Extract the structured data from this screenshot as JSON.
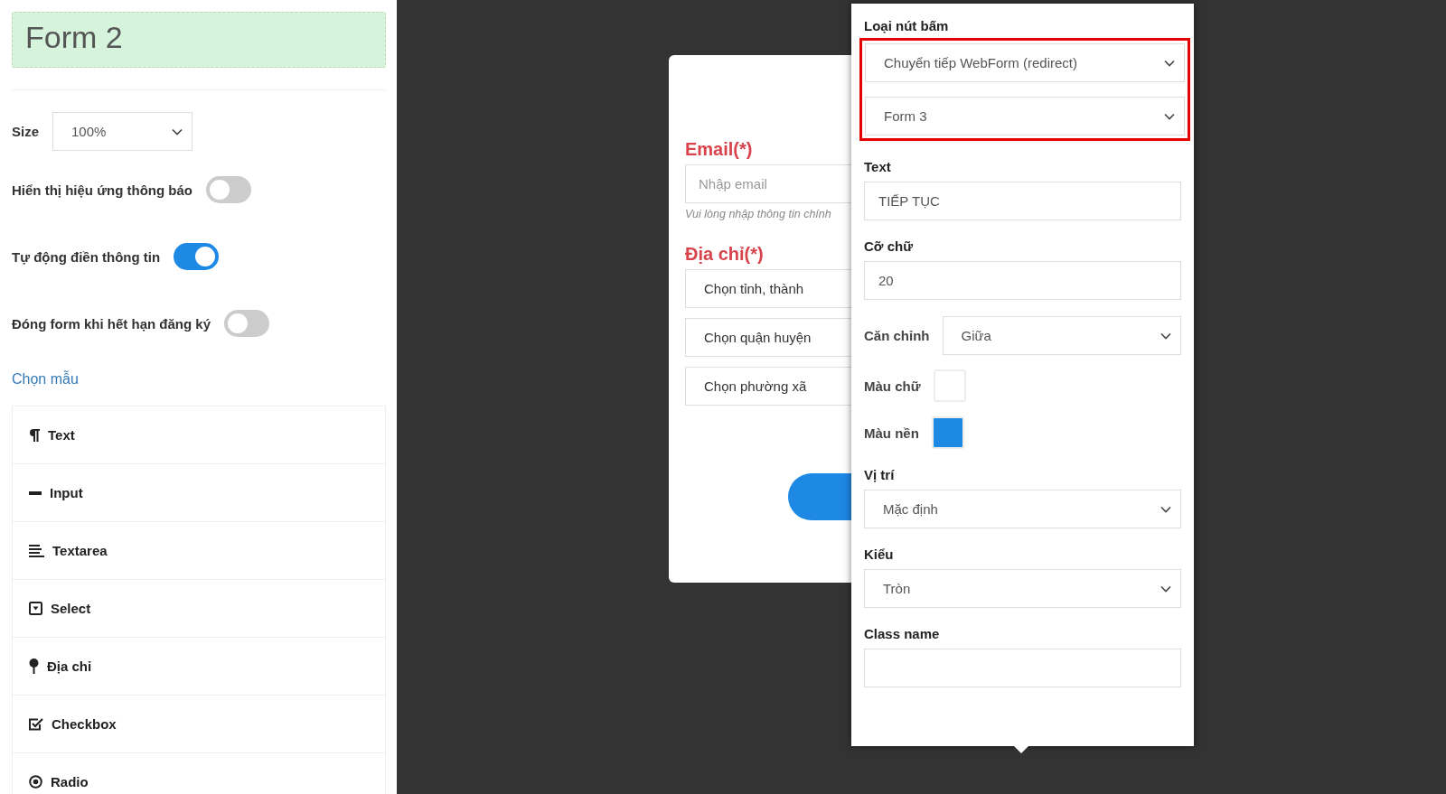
{
  "sidebar": {
    "title": "Form 2",
    "size": {
      "label": "Size",
      "value": "100%"
    },
    "toggles": [
      {
        "label": "Hiển thị hiệu ứng thông báo",
        "on": false
      },
      {
        "label": "Tự động điền thông tin",
        "on": true
      },
      {
        "label": "Đóng form khi hết hạn đăng ký",
        "on": false
      }
    ],
    "template_link": "Chọn mẫu",
    "items": [
      {
        "kind": "text",
        "label": "Text"
      },
      {
        "kind": "input",
        "label": "Input"
      },
      {
        "kind": "textarea",
        "label": "Textarea"
      },
      {
        "kind": "select",
        "label": "Select"
      },
      {
        "kind": "address",
        "label": "Địa chỉ"
      },
      {
        "kind": "checkbox",
        "label": "Checkbox"
      },
      {
        "kind": "radio",
        "label": "Radio"
      }
    ]
  },
  "form_preview": {
    "fields": [
      {
        "kind": "input",
        "label": "Email(*)",
        "placeholder": "Nhập email",
        "hint": "Vui lòng nhập thông tin chính"
      },
      {
        "kind": "address",
        "label": "Địa chỉ(*)",
        "options": [
          "Chọn tỉnh, thành",
          "Chọn quận huyện",
          "Chọn phường xã"
        ]
      }
    ]
  },
  "button_settings": {
    "type_label": "Loại nút bấm",
    "highlighted": true,
    "type_selects": [
      "Chuyển tiếp WebForm (redirect)",
      "Form 3"
    ],
    "fields": [
      {
        "kind": "input",
        "label": "Text",
        "value": "TIẾP TỤC"
      },
      {
        "kind": "input",
        "label": "Cỡ chữ",
        "value": "20"
      },
      {
        "kind": "inline_select",
        "label": "Căn chỉnh",
        "value": "Giữa"
      },
      {
        "kind": "color",
        "label": "Màu chữ",
        "color": "#ffffff"
      },
      {
        "kind": "color",
        "label": "Màu nền",
        "color": "#1e88e5"
      },
      {
        "kind": "select",
        "label": "Vị trí",
        "value": "Mặc định"
      },
      {
        "kind": "select",
        "label": "Kiểu",
        "value": "Tròn"
      },
      {
        "kind": "input",
        "label": "Class name"
      }
    ]
  }
}
